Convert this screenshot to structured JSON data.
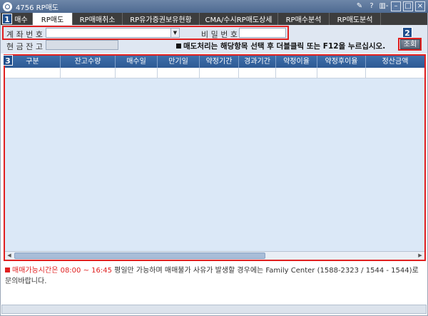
{
  "window": {
    "title": "4756 RP매도",
    "pin_icon": "pin-icon",
    "help_label": "?",
    "menu_label": "▥-",
    "minimize_label": "–",
    "maximize_label": "□",
    "close_label": "×"
  },
  "tabs": [
    {
      "label": "매수"
    },
    {
      "label": "RP매도"
    },
    {
      "label": "RP매매취소"
    },
    {
      "label": "RP유가증권보유현황"
    },
    {
      "label": "CMA/수시RP매도상세"
    },
    {
      "label": "RP매수분석"
    },
    {
      "label": "RP매도분석"
    }
  ],
  "badges": {
    "b1": "1",
    "b2": "2",
    "b3": "3"
  },
  "form": {
    "account_label": "계 좌 번 호",
    "password_label": "비 밀 번 호",
    "cash_label": "현 금 잔 고",
    "account_value": "",
    "password_value": "",
    "cash_value": ""
  },
  "notice": "매도처리는 해당항목 선택 후 더블클릭 또는 F12을 누르십시오.",
  "query_button": "조회",
  "grid": {
    "columns": [
      "구분",
      "잔고수량",
      "매수일",
      "만기일",
      "약정기간",
      "경과기간",
      "약정이율",
      "약정후이율",
      "정산금액"
    ]
  },
  "info": {
    "prefix": "매매가능시간은 08:00 ~ 16:45",
    "rest": " 평일만 가능하며 매매불가 사유가 발생할 경우에는 Family Center (1588-2323 / 1544 - 1544)로",
    "line2": "문의바랍니다."
  },
  "colors": {
    "accent_red": "#e02020",
    "header_blue": "#2e5a94",
    "grid_bg": "#dbe8f7"
  }
}
